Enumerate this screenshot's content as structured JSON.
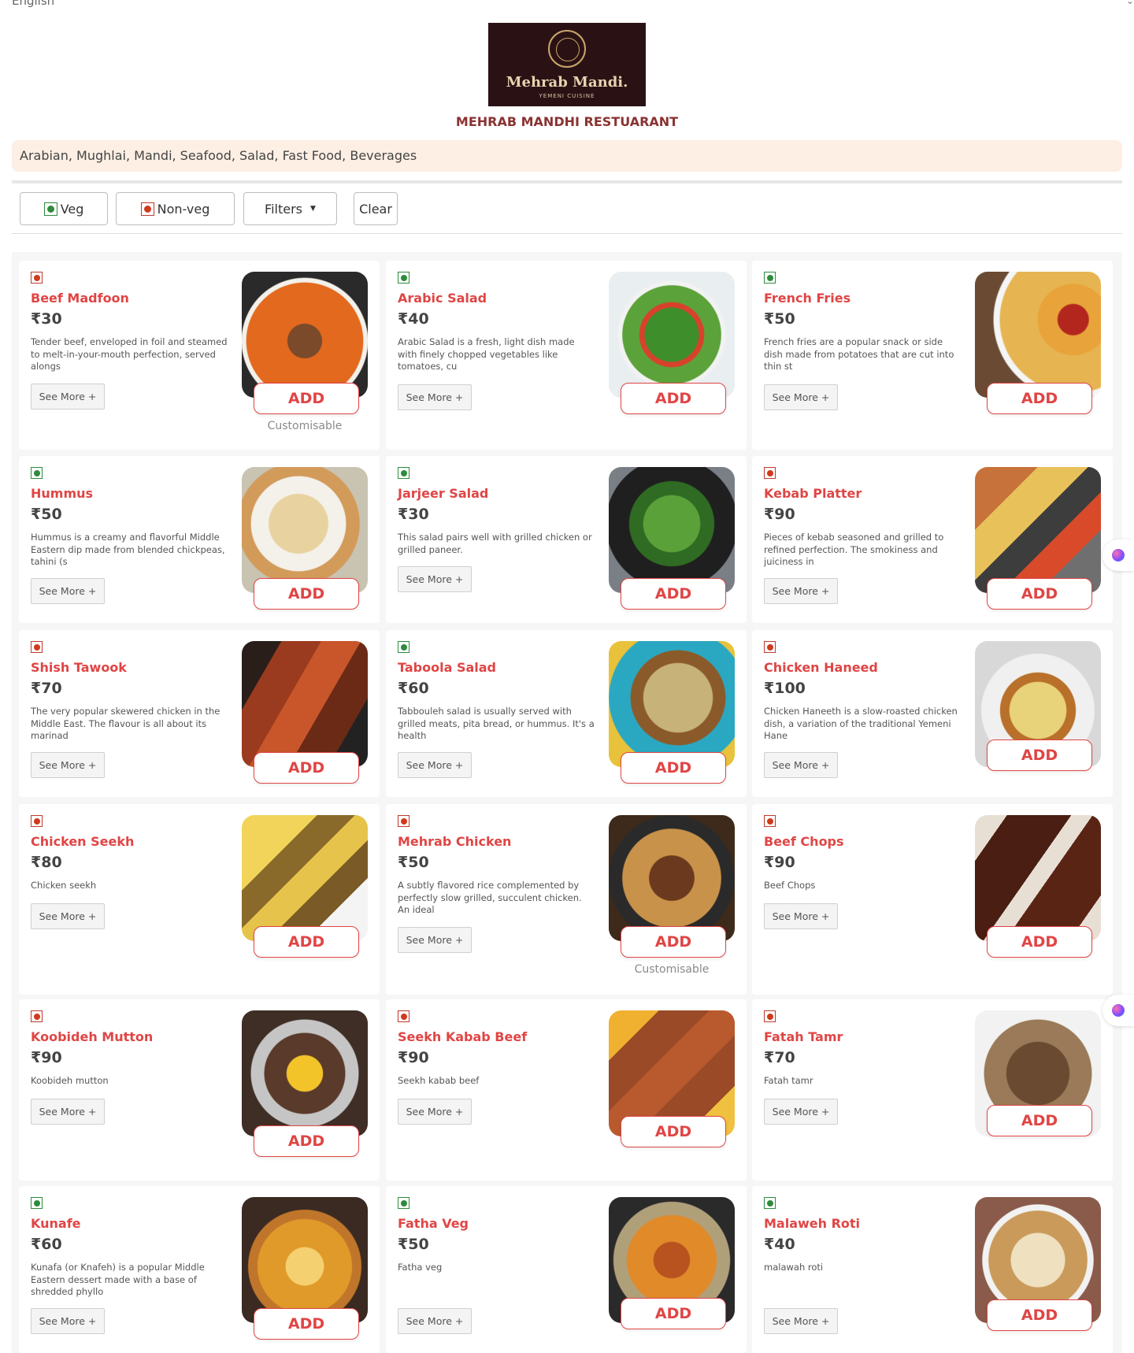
{
  "header": {
    "language": "English",
    "logo_name": "Mehrab Mandi.",
    "logo_sub": "YEMENI CUISINE",
    "restaurant_name": "MEHRAB MANDHI RESTUARANT",
    "cuisines": "Arabian, Mughlai, Mandi, Seafood, Salad, Fast Food, Beverages"
  },
  "filters": {
    "veg": "Veg",
    "nonveg": "Non-veg",
    "filters": "Filters",
    "clear": "Clear"
  },
  "labels": {
    "see_more": "See More +",
    "add": "ADD",
    "customisable": "Customisable"
  },
  "items": [
    {
      "name": "Beef Madfoon",
      "price": "₹30",
      "type": "non-veg",
      "desc": "Tender beef, enveloped in foil and steamed to melt-in-your-mouth perfection, served alongs",
      "customisable": true,
      "image": "beef-madfoon"
    },
    {
      "name": "Arabic Salad",
      "price": "₹40",
      "type": "veg",
      "desc": "Arabic Salad is a fresh, light dish made with finely chopped vegetables like tomatoes, cu",
      "customisable": false,
      "image": "arabic-salad"
    },
    {
      "name": "French Fries",
      "price": "₹50",
      "type": "veg",
      "desc": "French fries are a popular snack or side dish made from potatoes that are cut into thin st",
      "customisable": false,
      "image": "french-fries"
    },
    {
      "name": "Hummus",
      "price": "₹50",
      "type": "veg",
      "desc": "Hummus is a creamy and flavorful Middle Eastern dip made from blended chickpeas, tahini (s",
      "customisable": false,
      "image": "hummus"
    },
    {
      "name": "Jarjeer Salad",
      "price": "₹30",
      "type": "veg",
      "desc": "This salad pairs well with grilled chicken or grilled paneer.",
      "customisable": false,
      "image": "jarjeer-salad"
    },
    {
      "name": "Kebab Platter",
      "price": "₹90",
      "type": "non-veg",
      "desc": "Pieces of kebab seasoned and grilled to refined perfection. The smokiness and juiciness in",
      "customisable": false,
      "image": "kebab-platter"
    },
    {
      "name": "Shish Tawook",
      "price": "₹70",
      "type": "non-veg",
      "desc": "The very popular skewered chicken in the Middle East. The flavour is all about its marinad",
      "customisable": false,
      "image": "shish-tawook"
    },
    {
      "name": "Taboola Salad",
      "price": "₹60",
      "type": "veg",
      "desc": "Tabbouleh salad is usually served with grilled meats, pita bread, or hummus. It's a health",
      "customisable": false,
      "image": "taboola-salad"
    },
    {
      "name": "Chicken Haneed",
      "price": "₹100",
      "type": "non-veg",
      "desc": "Chicken Haneeth is a slow-roasted chicken dish, a variation of the traditional Yemeni Hane",
      "customisable": false,
      "image": "chicken-haneed"
    },
    {
      "name": "Chicken Seekh",
      "price": "₹80",
      "type": "non-veg",
      "desc": "Chicken seekh",
      "customisable": false,
      "image": "chicken-seekh"
    },
    {
      "name": "Mehrab Chicken",
      "price": "₹50",
      "type": "non-veg",
      "desc": "A subtly flavored rice complemented by perfectly slow grilled, succulent chicken. An ideal",
      "customisable": true,
      "image": "mehrab-chicken"
    },
    {
      "name": "Beef Chops",
      "price": "₹90",
      "type": "non-veg",
      "desc": "Beef Chops",
      "customisable": false,
      "image": "beef-chops"
    },
    {
      "name": "Koobideh Mutton",
      "price": "₹90",
      "type": "non-veg",
      "desc": "Koobideh mutton",
      "customisable": false,
      "image": "koobideh-mutton"
    },
    {
      "name": "Seekh Kabab Beef",
      "price": "₹90",
      "type": "non-veg",
      "desc": "Seekh kabab beef",
      "customisable": false,
      "image": "seekh-kabab-beef"
    },
    {
      "name": "Fatah Tamr",
      "price": "₹70",
      "type": "non-veg",
      "desc": "Fatah tamr",
      "customisable": false,
      "image": "fatah-tamr"
    },
    {
      "name": "Kunafe",
      "price": "₹60",
      "type": "veg",
      "desc": "Kunafa (or Knafeh) is a popular Middle Eastern dessert made with a base of shredded phyllo",
      "customisable": false,
      "image": "kunafe"
    },
    {
      "name": "Fatha Veg",
      "price": "₹50",
      "type": "veg",
      "desc": "Fatha veg",
      "customisable": false,
      "image": "fatha-veg"
    },
    {
      "name": "Malaweh Roti",
      "price": "₹40",
      "type": "veg",
      "desc": "malawah roti",
      "customisable": false,
      "image": "malaweh-roti"
    }
  ],
  "colors": {
    "accent": "#e04545",
    "veg": "#2e8b3c",
    "nonveg": "#d03a1c",
    "cuisine_bg": "#fdefe4",
    "title": "#8a3232"
  }
}
